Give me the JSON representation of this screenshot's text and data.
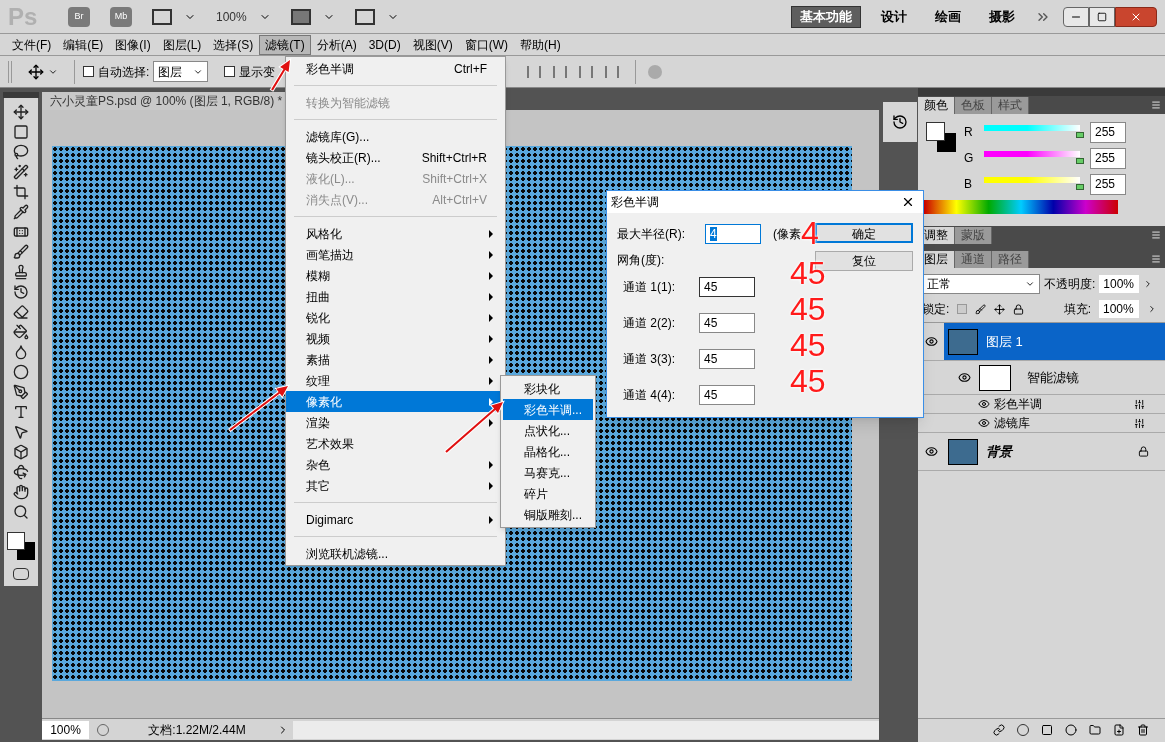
{
  "title_bar": {
    "logo": "Ps",
    "apps": [
      "Br",
      "Mb"
    ],
    "zoom": "100%",
    "workspaces": [
      {
        "label": "基本功能",
        "selected": true
      },
      {
        "label": "设计",
        "selected": false
      },
      {
        "label": "绘画",
        "selected": false
      },
      {
        "label": "摄影",
        "selected": false
      }
    ]
  },
  "menu_bar": [
    {
      "label": "文件(F)",
      "selected": false
    },
    {
      "label": "编辑(E)",
      "selected": false
    },
    {
      "label": "图像(I)",
      "selected": false
    },
    {
      "label": "图层(L)",
      "selected": false
    },
    {
      "label": "选择(S)",
      "selected": false
    },
    {
      "label": "滤镜(T)",
      "selected": true
    },
    {
      "label": "分析(A)",
      "selected": false
    },
    {
      "label": "3D(D)",
      "selected": false
    },
    {
      "label": "视图(V)",
      "selected": false
    },
    {
      "label": "窗口(W)",
      "selected": false
    },
    {
      "label": "帮助(H)",
      "selected": false
    }
  ],
  "options_bar": {
    "auto_select": {
      "label": "自动选择:",
      "checked": false
    },
    "auto_select_target": "图层",
    "show_transform": {
      "label": "显示变",
      "checked": false
    }
  },
  "document": {
    "tab": "六小灵童PS.psd @ 100% (图层 1, RGB/8) *",
    "zoom": "100%",
    "doc_info": "文档:1.22M/2.44M"
  },
  "filter_menu": [
    {
      "kind": "item",
      "label": "彩色半调",
      "shortcut": "Ctrl+F",
      "disabled": false,
      "selected": false
    },
    {
      "kind": "separator"
    },
    {
      "kind": "item",
      "label": "转换为智能滤镜",
      "disabled": true,
      "selected": false
    },
    {
      "kind": "separator"
    },
    {
      "kind": "item",
      "label": "滤镜库(G)...",
      "disabled": false,
      "selected": false
    },
    {
      "kind": "item",
      "label": "镜头校正(R)...",
      "shortcut": "Shift+Ctrl+R",
      "disabled": false,
      "selected": false
    },
    {
      "kind": "item",
      "label": "液化(L)...",
      "shortcut": "Shift+Ctrl+X",
      "disabled": true,
      "selected": false
    },
    {
      "kind": "item",
      "label": "消失点(V)...",
      "shortcut": "Alt+Ctrl+V",
      "disabled": true,
      "selected": false
    },
    {
      "kind": "separator"
    },
    {
      "kind": "submenu",
      "label": "风格化",
      "selected": false
    },
    {
      "kind": "submenu",
      "label": "画笔描边",
      "selected": false
    },
    {
      "kind": "submenu",
      "label": "模糊",
      "selected": false
    },
    {
      "kind": "submenu",
      "label": "扭曲",
      "selected": false
    },
    {
      "kind": "submenu",
      "label": "锐化",
      "selected": false
    },
    {
      "kind": "submenu",
      "label": "视频",
      "selected": false
    },
    {
      "kind": "submenu",
      "label": "素描",
      "selected": false
    },
    {
      "kind": "submenu",
      "label": "纹理",
      "selected": false
    },
    {
      "kind": "submenu",
      "label": "像素化",
      "selected": true
    },
    {
      "kind": "submenu",
      "label": "渲染",
      "selected": false
    },
    {
      "kind": "item",
      "label": "艺术效果",
      "disabled": false,
      "selected": false
    },
    {
      "kind": "submenu",
      "label": "杂色",
      "selected": false
    },
    {
      "kind": "submenu",
      "label": "其它",
      "selected": false
    },
    {
      "kind": "separator"
    },
    {
      "kind": "submenu",
      "label": "Digimarc",
      "selected": false
    },
    {
      "kind": "separator"
    },
    {
      "kind": "item",
      "label": "浏览联机滤镜...",
      "disabled": false,
      "selected": false
    }
  ],
  "pixelate_submenu": [
    {
      "label": "彩块化",
      "selected": false
    },
    {
      "label": "彩色半调...",
      "selected": true
    },
    {
      "label": "点状化...",
      "selected": false
    },
    {
      "label": "晶格化...",
      "selected": false
    },
    {
      "label": "马赛克...",
      "selected": false
    },
    {
      "label": "碎片",
      "selected": false
    },
    {
      "label": "铜版雕刻...",
      "selected": false
    }
  ],
  "dialog": {
    "title": "彩色半调",
    "max_radius": {
      "label": "最大半径(R):",
      "value": "4",
      "unit": "(像素"
    },
    "angles_label": "网角(度):",
    "channels": [
      {
        "label": "通道 1(1):",
        "value": "45",
        "focused": true
      },
      {
        "label": "通道 2(2):",
        "value": "45",
        "focused": false
      },
      {
        "label": "通道 3(3):",
        "value": "45",
        "focused": false
      },
      {
        "label": "通道 4(4):",
        "value": "45",
        "focused": false
      }
    ],
    "buttons": [
      {
        "label": "确定",
        "default": true
      },
      {
        "label": "复位",
        "default": false
      }
    ]
  },
  "annotations": [
    "4",
    "45",
    "45",
    "45",
    "45"
  ],
  "color_panel": {
    "tabs": [
      {
        "label": "颜色",
        "selected": true
      },
      {
        "label": "色板",
        "selected": false
      },
      {
        "label": "样式",
        "selected": false
      }
    ],
    "channels": [
      {
        "label": "R",
        "value": "255",
        "level": 1,
        "color": "#00ffff"
      },
      {
        "label": "G",
        "value": "255",
        "level": 1,
        "color": "#ff00ff"
      },
      {
        "label": "B",
        "value": "255",
        "level": 1,
        "color": "#ffff00"
      }
    ]
  },
  "adjust_panel": {
    "tabs": [
      {
        "label": "调整",
        "selected": true
      },
      {
        "label": "蒙版",
        "selected": false
      }
    ]
  },
  "layers_panel": {
    "tabs": [
      {
        "label": "图层",
        "selected": true
      },
      {
        "label": "通道",
        "selected": false
      },
      {
        "label": "路径",
        "selected": false
      }
    ],
    "blend_mode": "正常",
    "opacity_label": "不透明度:",
    "opacity": "100%",
    "lock_label": "锁定:",
    "fill_label": "填充:",
    "fill": "100%",
    "layers": [
      {
        "name": "图层 1",
        "selected": true,
        "visible": true,
        "locked": false,
        "children": [
          {
            "name": "智能滤镜",
            "visible": true,
            "children": [
              {
                "name": "彩色半调",
                "visible": true
              },
              {
                "name": "滤镜库",
                "visible": true
              }
            ]
          }
        ]
      },
      {
        "name": "背景",
        "selected": false,
        "visible": true,
        "locked": true
      }
    ]
  }
}
